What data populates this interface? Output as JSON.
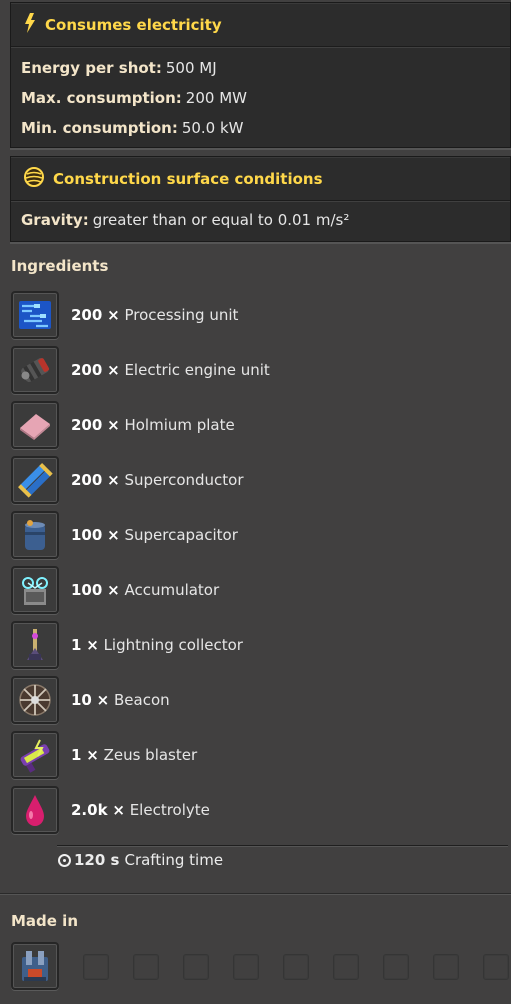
{
  "electric": {
    "title": "Consumes electricity",
    "rows": [
      {
        "label": "Energy per shot:",
        "value": "500 MJ"
      },
      {
        "label": "Max. consumption:",
        "value": "200 MW"
      },
      {
        "label": "Min. consumption:",
        "value": "50.0 kW"
      }
    ]
  },
  "surface": {
    "title": "Construction surface conditions",
    "rows": [
      {
        "label": "Gravity:",
        "value": "greater than or equal to 0.01 m/s²"
      }
    ]
  },
  "ingredients": {
    "title": "Ingredients",
    "items": [
      {
        "amount": "200",
        "name": "Processing unit",
        "icon": "processing-unit-icon"
      },
      {
        "amount": "200",
        "name": "Electric engine unit",
        "icon": "electric-engine-unit-icon"
      },
      {
        "amount": "200",
        "name": "Holmium plate",
        "icon": "holmium-plate-icon"
      },
      {
        "amount": "200",
        "name": "Superconductor",
        "icon": "superconductor-icon"
      },
      {
        "amount": "100",
        "name": "Supercapacitor",
        "icon": "supercapacitor-icon"
      },
      {
        "amount": "100",
        "name": "Accumulator",
        "icon": "accumulator-icon"
      },
      {
        "amount": "1",
        "name": "Lightning collector",
        "icon": "lightning-collector-icon"
      },
      {
        "amount": "10",
        "name": "Beacon",
        "icon": "beacon-icon"
      },
      {
        "amount": "1",
        "name": "Zeus blaster",
        "icon": "zeus-blaster-icon"
      },
      {
        "amount": "2.0k",
        "name": "Electrolyte",
        "icon": "electrolyte-icon"
      }
    ],
    "multiplier": "×"
  },
  "crafting": {
    "time": "120 s",
    "label": "Crafting time"
  },
  "made_in": {
    "title": "Made in",
    "machine_icon": "cryogenic-plant-icon"
  }
}
